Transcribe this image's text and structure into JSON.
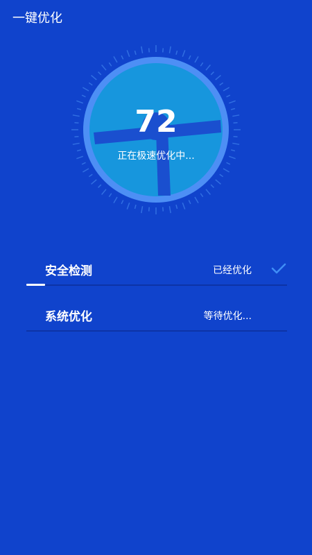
{
  "header": {
    "title": "一键优化"
  },
  "gauge": {
    "score": "72",
    "status": "正在极速优化中..."
  },
  "tasks": [
    {
      "label": "安全检测",
      "status": "已经优化",
      "done": true
    },
    {
      "label": "系统优化",
      "status": "等待优化...",
      "done": false
    }
  ],
  "colors": {
    "background": "#1043cc",
    "ring": "#4d8ff5",
    "dial": "#1796dd",
    "fan": "#1a4fcf",
    "check": "#3f8ef6",
    "divider": "#0d33a6"
  },
  "icons": {
    "check": "check-icon",
    "fan": "fan-icon"
  }
}
